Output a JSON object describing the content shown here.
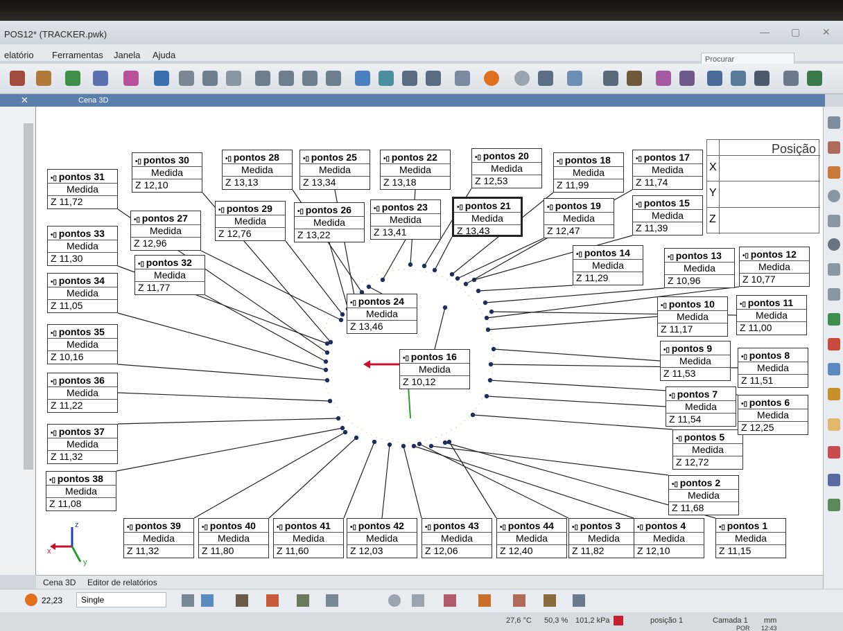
{
  "window": {
    "title": "POS12* (TRACKER.pwk)",
    "search_placeholder": "Procurar"
  },
  "menu": [
    "elatório",
    "Ferramentas",
    "Janela",
    "Ajuda"
  ],
  "panel": {
    "title": "Cena 3D"
  },
  "position_table": {
    "title": "Posição",
    "rows": [
      "X",
      "Y",
      "Z"
    ]
  },
  "scene": {
    "points": [
      {
        "label": "pontos 1",
        "measure": "Medida",
        "z": "Z  11,15"
      },
      {
        "label": "pontos 2",
        "measure": "Medida",
        "z": "Z  11,68"
      },
      {
        "label": "pontos 3",
        "measure": "Medida",
        "z": "Z  11,82"
      },
      {
        "label": "pontos 4",
        "measure": "Medida",
        "z": "Z  12,10"
      },
      {
        "label": "pontos 5",
        "measure": "Medida",
        "z": "Z  12,72"
      },
      {
        "label": "pontos 6",
        "measure": "Medida",
        "z": "Z  12,25"
      },
      {
        "label": "pontos 7",
        "measure": "Medida",
        "z": "Z  11,54"
      },
      {
        "label": "pontos 8",
        "measure": "Medida",
        "z": "Z  11,51"
      },
      {
        "label": "pontos 9",
        "measure": "Medida",
        "z": "Z  11,53"
      },
      {
        "label": "pontos 10",
        "measure": "Medida",
        "z": "Z  11,17"
      },
      {
        "label": "pontos 11",
        "measure": "Medida",
        "z": "Z  11,00"
      },
      {
        "label": "pontos 12",
        "measure": "Medida",
        "z": "Z  10,77"
      },
      {
        "label": "pontos 13",
        "measure": "Medida",
        "z": "Z  10,96"
      },
      {
        "label": "pontos 14",
        "measure": "Medida",
        "z": "Z  11,29"
      },
      {
        "label": "pontos 15",
        "measure": "Medida",
        "z": "Z  11,39"
      },
      {
        "label": "pontos 16",
        "measure": "Medida",
        "z": "Z  10,12"
      },
      {
        "label": "pontos 17",
        "measure": "Medida",
        "z": "Z  11,74"
      },
      {
        "label": "pontos 18",
        "measure": "Medida",
        "z": "Z  11,99"
      },
      {
        "label": "pontos 19",
        "measure": "Medida",
        "z": "Z  12,47"
      },
      {
        "label": "pontos 20",
        "measure": "Medida",
        "z": "Z  12,53"
      },
      {
        "label": "pontos 21",
        "measure": "Medida",
        "z": "Z  13,43"
      },
      {
        "label": "pontos 22",
        "measure": "Medida",
        "z": "Z  13,18"
      },
      {
        "label": "pontos 23",
        "measure": "Medida",
        "z": "Z  13,41"
      },
      {
        "label": "pontos 24",
        "measure": "Medida",
        "z": "Z  13,46"
      },
      {
        "label": "pontos 25",
        "measure": "Medida",
        "z": "Z  13,34"
      },
      {
        "label": "pontos 26",
        "measure": "Medida",
        "z": "Z  13,22"
      },
      {
        "label": "pontos 27",
        "measure": "Medida",
        "z": "Z  12,96"
      },
      {
        "label": "pontos 28",
        "measure": "Medida",
        "z": "Z  13,13"
      },
      {
        "label": "pontos 29",
        "measure": "Medida",
        "z": "Z  12,76"
      },
      {
        "label": "pontos 30",
        "measure": "Medida",
        "z": "Z  12,10"
      },
      {
        "label": "pontos 31",
        "measure": "Medida",
        "z": "Z  11,72"
      },
      {
        "label": "pontos 32",
        "measure": "Medida",
        "z": "Z  11,77"
      },
      {
        "label": "pontos 33",
        "measure": "Medida",
        "z": "Z  11,30"
      },
      {
        "label": "pontos 34",
        "measure": "Medida",
        "z": "Z  11,05"
      },
      {
        "label": "pontos 35",
        "measure": "Medida",
        "z": "Z  10,16"
      },
      {
        "label": "pontos 36",
        "measure": "Medida",
        "z": "Z  11,22"
      },
      {
        "label": "pontos 37",
        "measure": "Medida",
        "z": "Z  11,32"
      },
      {
        "label": "pontos 38",
        "measure": "Medida",
        "z": "Z  11,08"
      },
      {
        "label": "pontos 39",
        "measure": "Medida",
        "z": "Z  11,32"
      },
      {
        "label": "pontos 40",
        "measure": "Medida",
        "z": "Z  11,80"
      },
      {
        "label": "pontos 41",
        "measure": "Medida",
        "z": "Z  11,60"
      },
      {
        "label": "pontos 42",
        "measure": "Medida",
        "z": "Z  12,03"
      },
      {
        "label": "pontos 43",
        "measure": "Medida",
        "z": "Z  12,06"
      },
      {
        "label": "pontos 44",
        "measure": "Medida",
        "z": "Z  12,40"
      }
    ],
    "selected": "pontos 21"
  },
  "tabs": [
    "Cena 3D",
    "Editor de relatórios"
  ],
  "bottom": {
    "point_count": "22,23",
    "mode": "Single"
  },
  "status": {
    "temperature": "27,6 °C",
    "humidity": "50,3 %",
    "pressure": "101,2 kPa",
    "position": "posição 1",
    "layer": "Camada 1",
    "unit": "mm",
    "lang": "POR",
    "time": "12:43"
  },
  "axis": {
    "x": "x",
    "y": "y",
    "z": "z"
  },
  "colors": {
    "panel": "#5b7fa8",
    "scene_bg": "#ffffff",
    "dot": "#1f2d5c",
    "arrow_x": "#c8102e",
    "arrow_y": "#2a9d2a",
    "arrow_z": "#1f3fbf"
  }
}
